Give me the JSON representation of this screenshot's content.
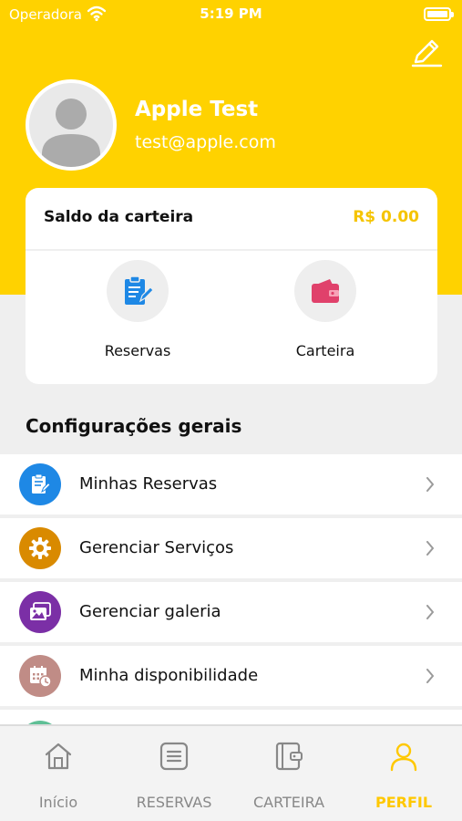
{
  "status_bar": {
    "carrier": "Operadora",
    "time": "5:19 PM"
  },
  "profile": {
    "name": "Apple Test",
    "email": "test@apple.com"
  },
  "wallet": {
    "label": "Saldo da carteira",
    "amount": "R$ 0.00",
    "actions": [
      {
        "label": "Reservas",
        "icon": "clipboard-edit-icon"
      },
      {
        "label": "Carteira",
        "icon": "wallet-icon"
      }
    ]
  },
  "settings": {
    "title": "Configurações gerais",
    "items": [
      {
        "label": "Minhas Reservas",
        "icon": "clipboard-icon",
        "color": "#1e88e5"
      },
      {
        "label": "Gerenciar Serviços",
        "icon": "gear-icon",
        "color": "#d98a00"
      },
      {
        "label": "Gerenciar galeria",
        "icon": "gallery-icon",
        "color": "#7b2fa6"
      },
      {
        "label": "Minha disponibilidade",
        "icon": "calendar-clock-icon",
        "color": "#c08c86"
      }
    ]
  },
  "tabbar": {
    "items": [
      {
        "label": "Início",
        "icon": "home-icon"
      },
      {
        "label": "RESERVAS",
        "icon": "list-icon"
      },
      {
        "label": "CARTEIRA",
        "icon": "wallet-icon"
      },
      {
        "label": "PERFIL",
        "icon": "user-icon"
      }
    ],
    "active": "PERFIL"
  },
  "colors": {
    "accent": "#ffd200",
    "wallet_amount": "#f5c400",
    "inactive_tab": "#888888"
  }
}
